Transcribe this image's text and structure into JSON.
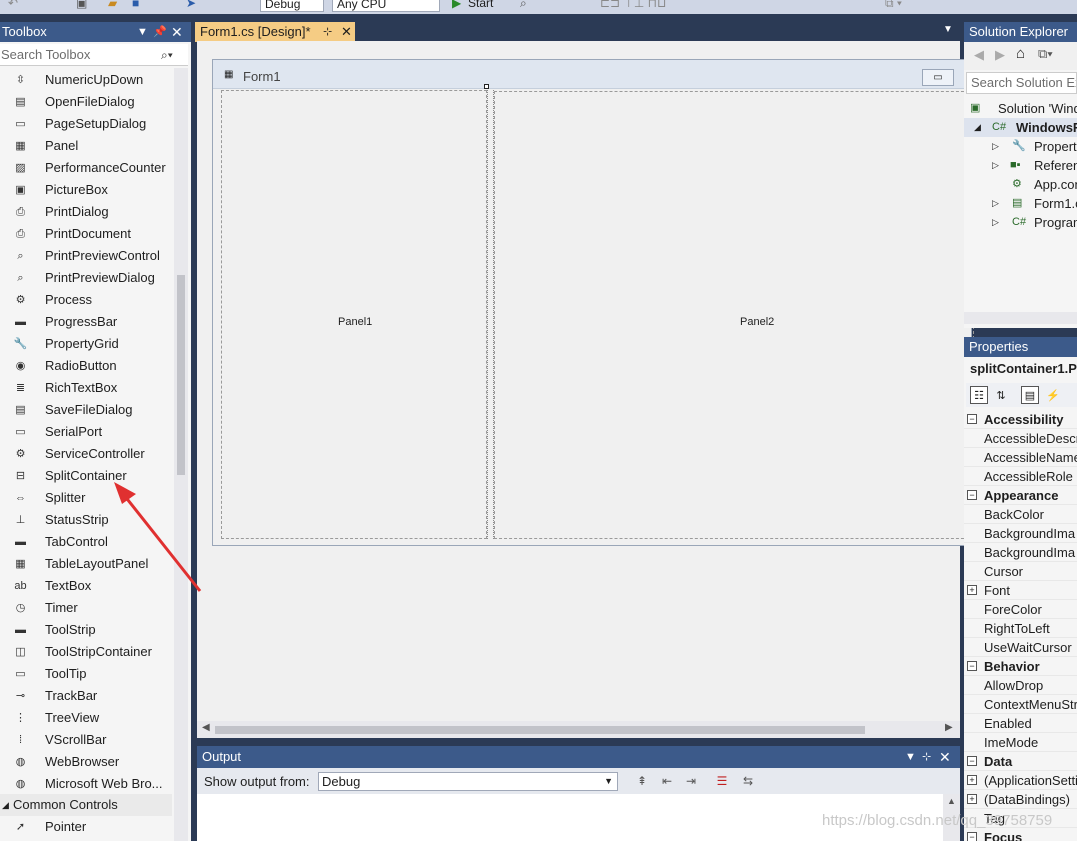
{
  "topbar": {
    "config": "Debug",
    "platform": "Any CPU",
    "start": "Start"
  },
  "toolbox": {
    "title": "Toolbox",
    "search_placeholder": "Search Toolbox",
    "items": [
      {
        "label": "NumericUpDown",
        "icon": "numeric-updown-icon"
      },
      {
        "label": "OpenFileDialog",
        "icon": "open-file-dialog-icon"
      },
      {
        "label": "PageSetupDialog",
        "icon": "page-setup-icon"
      },
      {
        "label": "Panel",
        "icon": "panel-icon"
      },
      {
        "label": "PerformanceCounter",
        "icon": "performance-counter-icon"
      },
      {
        "label": "PictureBox",
        "icon": "picture-box-icon"
      },
      {
        "label": "PrintDialog",
        "icon": "print-dialog-icon"
      },
      {
        "label": "PrintDocument",
        "icon": "print-document-icon"
      },
      {
        "label": "PrintPreviewControl",
        "icon": "print-preview-control-icon"
      },
      {
        "label": "PrintPreviewDialog",
        "icon": "print-preview-dialog-icon"
      },
      {
        "label": "Process",
        "icon": "process-icon"
      },
      {
        "label": "ProgressBar",
        "icon": "progress-bar-icon"
      },
      {
        "label": "PropertyGrid",
        "icon": "property-grid-icon"
      },
      {
        "label": "RadioButton",
        "icon": "radio-button-icon"
      },
      {
        "label": "RichTextBox",
        "icon": "rich-textbox-icon"
      },
      {
        "label": "SaveFileDialog",
        "icon": "save-file-dialog-icon"
      },
      {
        "label": "SerialPort",
        "icon": "serial-port-icon"
      },
      {
        "label": "ServiceController",
        "icon": "service-controller-icon"
      },
      {
        "label": "SplitContainer",
        "icon": "split-container-icon"
      },
      {
        "label": "Splitter",
        "icon": "splitter-icon"
      },
      {
        "label": "StatusStrip",
        "icon": "status-strip-icon"
      },
      {
        "label": "TabControl",
        "icon": "tab-control-icon"
      },
      {
        "label": "TableLayoutPanel",
        "icon": "table-layout-panel-icon"
      },
      {
        "label": "TextBox",
        "icon": "textbox-icon"
      },
      {
        "label": "Timer",
        "icon": "timer-icon"
      },
      {
        "label": "ToolStrip",
        "icon": "tool-strip-icon"
      },
      {
        "label": "ToolStripContainer",
        "icon": "tool-strip-container-icon"
      },
      {
        "label": "ToolTip",
        "icon": "tooltip-icon"
      },
      {
        "label": "TrackBar",
        "icon": "trackbar-icon"
      },
      {
        "label": "TreeView",
        "icon": "treeview-icon"
      },
      {
        "label": "VScrollBar",
        "icon": "vscrollbar-icon"
      },
      {
        "label": "WebBrowser",
        "icon": "web-browser-icon"
      },
      {
        "label": "Microsoft Web Bro...",
        "icon": "ms-web-browser-icon"
      }
    ],
    "category": "Common Controls",
    "category_first_item": "Pointer"
  },
  "document_tab": {
    "title": "Form1.cs [Design]*"
  },
  "designer": {
    "form_title": "Form1",
    "panel1_label": "Panel1",
    "panel2_label": "Panel2"
  },
  "output": {
    "title": "Output",
    "show_from_label": "Show output from:",
    "source": "Debug"
  },
  "solution_explorer": {
    "title": "Solution Explorer",
    "search_placeholder": "Search Solution Ex",
    "items": [
      {
        "label": "Solution 'Wind"
      },
      {
        "label": "WindowsF"
      },
      {
        "label": "Propert"
      },
      {
        "label": "Referen"
      },
      {
        "label": "App.con"
      },
      {
        "label": "Form1.c"
      },
      {
        "label": "Program"
      }
    ]
  },
  "properties": {
    "title": "Properties",
    "object": "splitContainer1.P",
    "rows": [
      {
        "label": "Accessibility",
        "category": true
      },
      {
        "label": "AccessibleDescr",
        "category": false
      },
      {
        "label": "AccessibleName",
        "category": false
      },
      {
        "label": "AccessibleRole",
        "category": false
      },
      {
        "label": "Appearance",
        "category": true
      },
      {
        "label": "BackColor",
        "category": false
      },
      {
        "label": "BackgroundIma",
        "category": false
      },
      {
        "label": "BackgroundIma",
        "category": false
      },
      {
        "label": "Cursor",
        "category": false
      },
      {
        "label": "Font",
        "category": false,
        "expandable": true
      },
      {
        "label": "ForeColor",
        "category": false
      },
      {
        "label": "RightToLeft",
        "category": false
      },
      {
        "label": "UseWaitCursor",
        "category": false
      },
      {
        "label": "Behavior",
        "category": true
      },
      {
        "label": "AllowDrop",
        "category": false
      },
      {
        "label": "ContextMenuStr",
        "category": false
      },
      {
        "label": "Enabled",
        "category": false
      },
      {
        "label": "ImeMode",
        "category": false
      },
      {
        "label": "Data",
        "category": true
      },
      {
        "label": "(ApplicationSetti",
        "category": false,
        "expandable": true
      },
      {
        "label": "(DataBindings)",
        "category": false,
        "expandable": true
      },
      {
        "label": "Tag",
        "category": false
      },
      {
        "label": "Focus",
        "category": true
      }
    ]
  },
  "watermark": "https://blog.csdn.net/qq_39758759",
  "colors": {
    "chrome": "#2b3a55",
    "panel_header": "#3c5a8a",
    "active_tab": "#f5cc84",
    "annotation_arrow": "#e03030"
  }
}
